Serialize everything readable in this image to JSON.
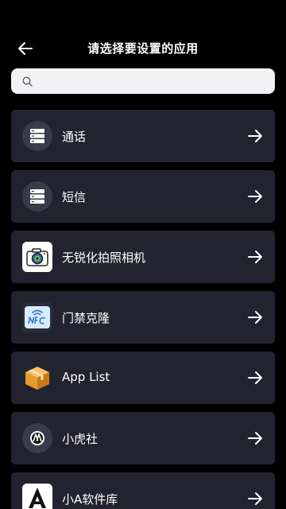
{
  "header": {
    "title": "请选择要设置的应用",
    "back_icon": "arrow-left-icon"
  },
  "search": {
    "placeholder": "",
    "value": "",
    "icon": "search-icon"
  },
  "apps": [
    {
      "label": "通话",
      "icon": "server-icon"
    },
    {
      "label": "短信",
      "icon": "server-icon"
    },
    {
      "label": "无锐化拍照相机",
      "icon": "camera-icon"
    },
    {
      "label": "门禁克隆",
      "icon": "nfc-icon"
    },
    {
      "label": "App List",
      "icon": "box-icon"
    },
    {
      "label": "小虎社",
      "icon": "tiger-icon"
    },
    {
      "label": "小A软件库",
      "icon": "a-logo-icon"
    }
  ],
  "colors": {
    "background": "#000000",
    "card": "#232330",
    "search_bg": "#f2f2f5",
    "text": "#ffffff"
  }
}
